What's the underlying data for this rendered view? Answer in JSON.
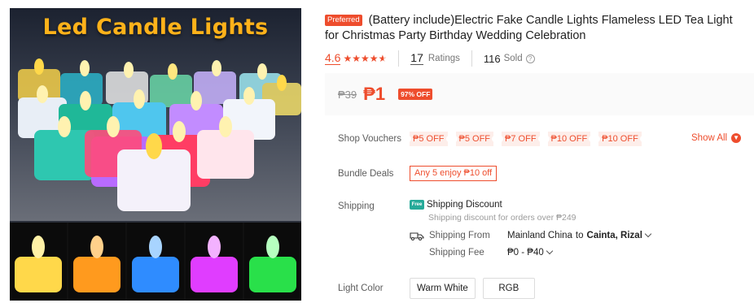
{
  "image": {
    "hero_title": "Led Candle Lights",
    "thumb_colors": [
      "#ffd84a",
      "#ff9a1e",
      "#2f8cff",
      "#e03dff",
      "#29e04a"
    ]
  },
  "product": {
    "preferred_badge": "Preferred",
    "title": "(Battery include)Electric Fake Candle Lights Flameless LED Tea Light for Christmas Party Birthday Wedding Celebration"
  },
  "rating": {
    "value": "4.6",
    "stars": 4.6,
    "ratings_count": "17",
    "ratings_label": "Ratings",
    "sold_count": "116",
    "sold_label": "Sold"
  },
  "price": {
    "original": "₱39",
    "current": "₱1",
    "discount": "97% OFF"
  },
  "vouchers": {
    "label": "Shop Vouchers",
    "items": [
      "₱5 OFF",
      "₱5 OFF",
      "₱7 OFF",
      "₱10 OFF",
      "₱10 OFF"
    ],
    "show_all": "Show All"
  },
  "bundle": {
    "label": "Bundle Deals",
    "deal": "Any 5 enjoy ₱10 off"
  },
  "shipping": {
    "label": "Shipping",
    "free_icon": "Free",
    "discount_title": "Shipping Discount",
    "discount_desc": "Shipping discount for orders over ₱249",
    "from_label": "Shipping From",
    "from_value": "Mainland China",
    "to_word": "to",
    "to_value": "Cainta, Rizal",
    "fee_label": "Shipping Fee",
    "fee_value": "₱0 - ₱40"
  },
  "variation": {
    "label": "Light Color",
    "options": [
      "Warm White",
      "RGB"
    ]
  },
  "colors": {
    "accent": "#ee4d2d",
    "teal": "#26aa99"
  }
}
